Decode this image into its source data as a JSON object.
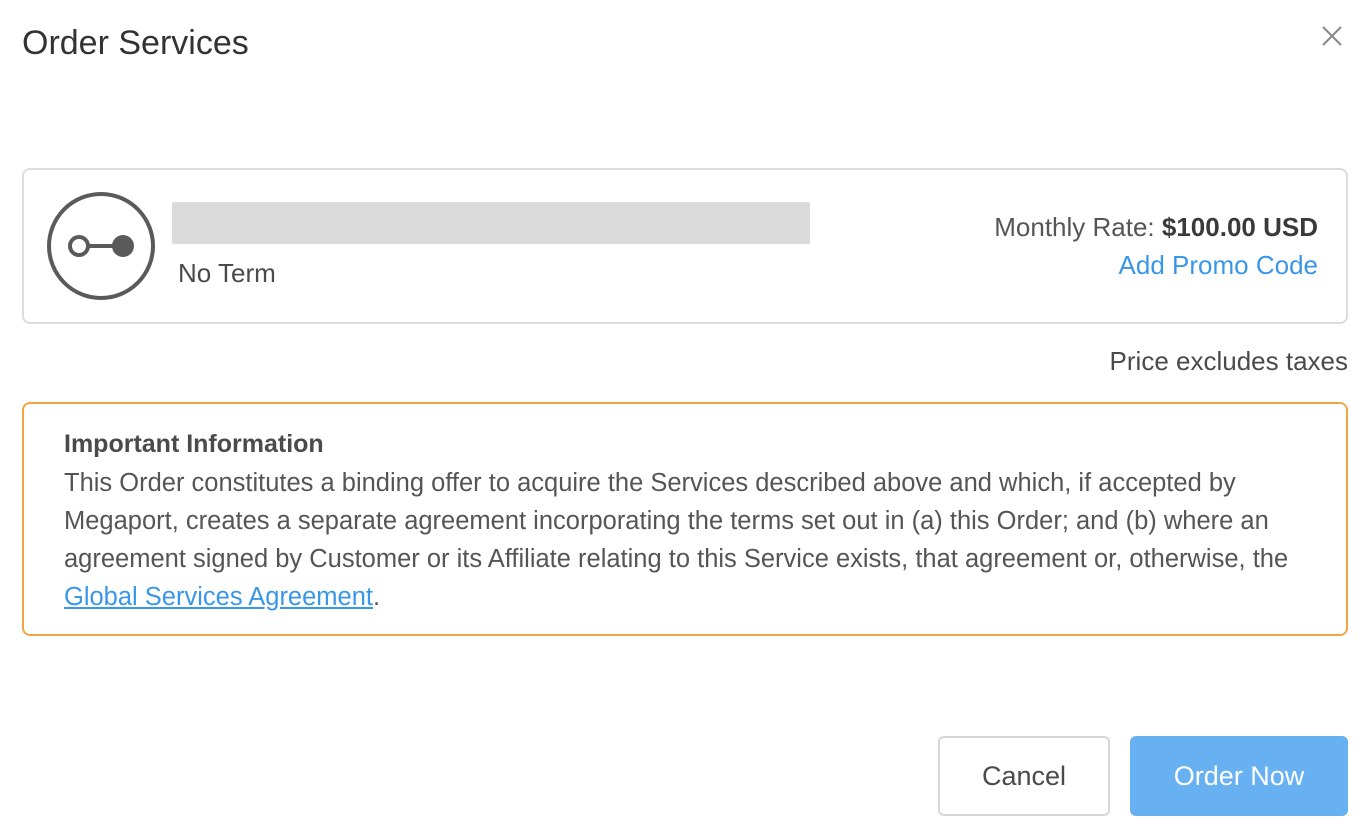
{
  "dialog": {
    "title": "Order Services"
  },
  "service": {
    "icon": "connection-icon",
    "term": "No Term",
    "monthly_rate_label": "Monthly Rate:",
    "monthly_rate_value": "$100.00 USD",
    "promo_link": "Add Promo Code"
  },
  "tax_note": "Price excludes taxes",
  "info": {
    "heading": "Important Information",
    "body_before_link": "This Order constitutes a binding offer to acquire the Services described above and which, if accepted by Megaport, creates a separate agreement incorporating the terms set out in (a) this Order; and (b) where an agreement signed by Customer or its Affiliate relating to this Service exists, that agreement or, otherwise, the ",
    "link_text": "Global Services Agreement",
    "body_after_link": "."
  },
  "buttons": {
    "cancel": "Cancel",
    "order_now": "Order Now"
  },
  "colors": {
    "accent": "#3a97e8",
    "primary_button": "#67b0f2",
    "warning_border": "#f2a541"
  }
}
